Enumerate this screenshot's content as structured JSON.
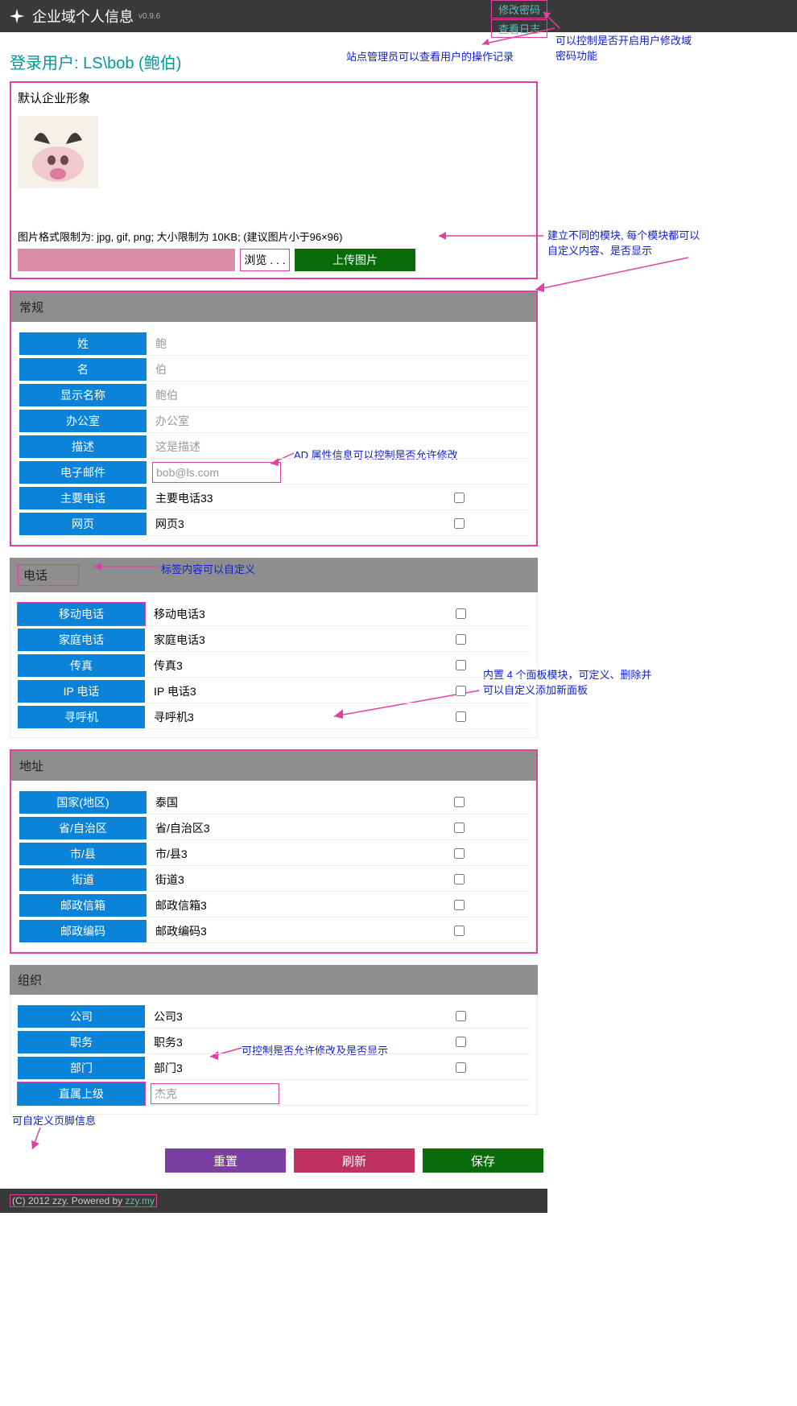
{
  "app": {
    "title": "企业域个人信息",
    "version": "v0.9.6"
  },
  "top_links": {
    "change_pw": "修改密码",
    "view_log": "查看日志"
  },
  "notes": {
    "n1": "可以控制是否开启用户修改域密码功能",
    "n2": "站点管理员可以查看用户的操作记录",
    "n3": "建立不同的模块, 每个模块都可以自定义内容、是否显示",
    "n4": "AD 属性信息可以控制是否允许修改",
    "n5": "标签内容可以自定义",
    "n6": "内置 4 个面板模块，可定义、删除并可以自定义添加新面板",
    "n7": "可控制是否允许修改及是否显示",
    "n8": "可自定义页脚信息"
  },
  "login_user": "登录用户: LS\\bob (鲍伯)",
  "avatar": {
    "title": "默认企业形象",
    "hint": "图片格式限制为: jpg, gif, png; 大小限制为 10KB; (建议图片小于96×96)",
    "browse": "浏览 . . .",
    "upload": "上传图片"
  },
  "section_general": {
    "title": "常规",
    "rows": [
      {
        "label": "姓",
        "value": "鲍",
        "ro": true
      },
      {
        "label": "名",
        "value": "伯",
        "ro": true
      },
      {
        "label": "显示名称",
        "value": "鲍伯",
        "ro": true
      },
      {
        "label": "办公室",
        "value": "办公室",
        "ro": true
      },
      {
        "label": "描述",
        "value": "这是描述",
        "ro": true
      },
      {
        "label": "电子邮件",
        "value": "bob@ls.com",
        "ro": true,
        "hl": true
      },
      {
        "label": "主要电话",
        "value": "主要电话33",
        "cb": true
      },
      {
        "label": "网页",
        "value": "网页3",
        "cb": true
      }
    ]
  },
  "section_phone": {
    "title": "电话",
    "rows": [
      {
        "label": "移动电话",
        "value": "移动电话3",
        "cb": true,
        "lbl_hl": true
      },
      {
        "label": "家庭电话",
        "value": "家庭电话3",
        "cb": true
      },
      {
        "label": "传真",
        "value": "传真3",
        "cb": true
      },
      {
        "label": "IP 电话",
        "value": "IP 电话3",
        "cb": true
      },
      {
        "label": "寻呼机",
        "value": "寻呼机3",
        "cb": true
      }
    ]
  },
  "section_address": {
    "title": "地址",
    "rows": [
      {
        "label": "国家(地区)",
        "value": "泰国",
        "cb": true
      },
      {
        "label": "省/自治区",
        "value": "省/自治区3",
        "cb": true
      },
      {
        "label": "市/县",
        "value": "市/县3",
        "cb": true
      },
      {
        "label": "街道",
        "value": "街道3",
        "cb": true
      },
      {
        "label": "邮政信箱",
        "value": "邮政信箱3",
        "cb": true
      },
      {
        "label": "邮政编码",
        "value": "邮政编码3",
        "cb": true
      }
    ]
  },
  "section_org": {
    "title": "组织",
    "rows": [
      {
        "label": "公司",
        "value": "公司3",
        "cb": true
      },
      {
        "label": "职务",
        "value": "职务3",
        "cb": true
      },
      {
        "label": "部门",
        "value": "部门3",
        "cb": true
      },
      {
        "label": "直属上级",
        "value": "杰克",
        "ro": true,
        "hl": true,
        "lbl_hl": true
      }
    ]
  },
  "actions": {
    "reset": "重置",
    "refresh": "刷新",
    "save": "保存"
  },
  "footer": {
    "copy": "(C) 2012 zzy.  Powered by ",
    "link": "zzy.my"
  }
}
